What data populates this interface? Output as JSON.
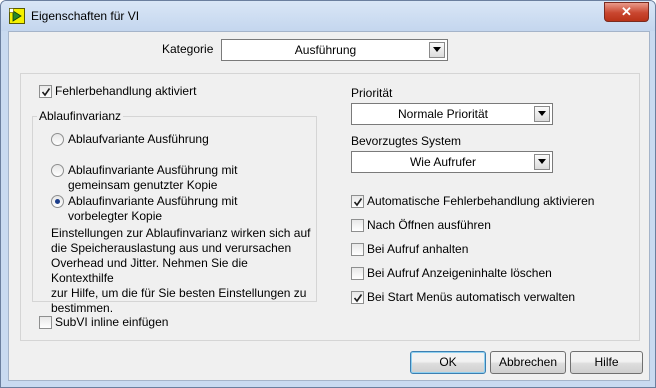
{
  "window": {
    "title": "Eigenschaften für VI",
    "close_glyph": "✕",
    "icon": "labview-vi-icon"
  },
  "category": {
    "label": "Kategorie",
    "value": "Ausführung"
  },
  "error_handling": {
    "label": "Fehlerbehandlung aktiviert",
    "checked": true
  },
  "reentrancy": {
    "title": "Ablaufinvarianz",
    "options": [
      {
        "label": "Ablaufvariante Ausführung",
        "selected": false
      },
      {
        "line1": "Ablaufinvariante Ausführung mit",
        "line2": "gemeinsam genutzter Kopie",
        "selected": false
      },
      {
        "line1": "Ablaufinvariante Ausführung mit",
        "line2": "vorbelegter Kopie",
        "selected": true
      }
    ],
    "info_lines": [
      "Einstellungen zur Ablaufinvarianz wirken sich auf",
      "die Speicherauslastung aus und verursachen",
      "Overhead und Jitter. Nehmen Sie die Kontexthilfe",
      "zur Hilfe, um die für Sie besten Einstellungen zu",
      "bestimmen."
    ]
  },
  "inline": {
    "label": "SubVI inline einfügen",
    "checked": false
  },
  "priority": {
    "label": "Priorität",
    "value": "Normale Priorität"
  },
  "preferred_system": {
    "label": "Bevorzugtes System",
    "value": "Wie Aufrufer"
  },
  "options": [
    {
      "label": "Automatische Fehlerbehandlung aktivieren",
      "checked": true
    },
    {
      "label": "Nach Öffnen ausführen",
      "checked": false
    },
    {
      "label": "Bei Aufruf anhalten",
      "checked": false
    },
    {
      "label": "Bei Aufruf Anzeigeninhalte löschen",
      "checked": false
    },
    {
      "label": "Bei Start Menüs automatisch verwalten",
      "checked": true
    }
  ],
  "buttons": {
    "ok": "OK",
    "cancel": "Abbrechen",
    "help": "Hilfe"
  }
}
